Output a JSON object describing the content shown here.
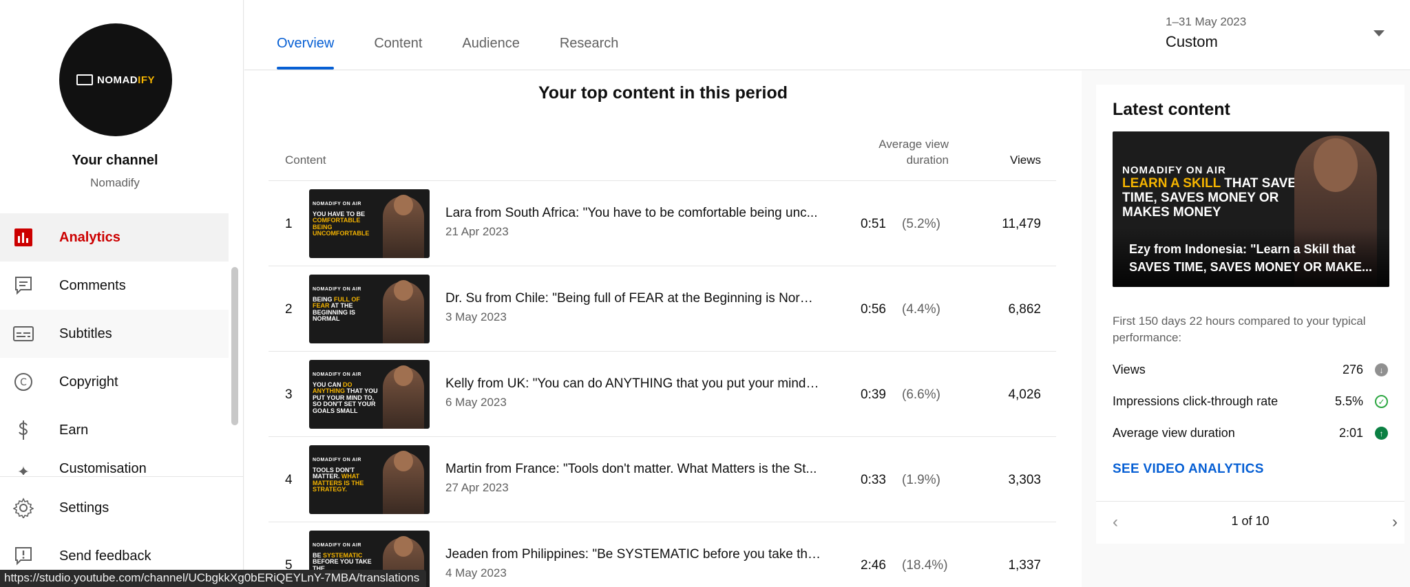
{
  "sidebar": {
    "logo_main": "NOMAD",
    "logo_accent": "IFY",
    "channel_title": "Your channel",
    "channel_name": "Nomadify",
    "items": [
      {
        "label": "Analytics",
        "icon": "analytics-icon"
      },
      {
        "label": "Comments",
        "icon": "comments-icon"
      },
      {
        "label": "Subtitles",
        "icon": "subtitles-icon"
      },
      {
        "label": "Copyright",
        "icon": "copyright-icon"
      },
      {
        "label": "Earn",
        "icon": "dollar-icon"
      },
      {
        "label": "Customisation",
        "icon": "customisation-icon"
      }
    ],
    "bottom_items": [
      {
        "label": "Settings",
        "icon": "gear-icon"
      },
      {
        "label": "Send feedback",
        "icon": "feedback-icon"
      }
    ]
  },
  "header": {
    "tabs": [
      "Overview",
      "Content",
      "Audience",
      "Research"
    ],
    "active_tab": "Overview",
    "date_range_sub": "1–31 May 2023",
    "date_range_value": "Custom"
  },
  "top_content": {
    "title": "Your top content in this period",
    "columns": {
      "content": "Content",
      "avd_line1": "Average view",
      "avd_line2": "duration",
      "views": "Views"
    },
    "rows": [
      {
        "rank": "1",
        "title": "Lara from South Africa: \"You have to be comfortable being unc...",
        "date": "21 Apr 2023",
        "duration": "0:51",
        "pct": "(5.2%)",
        "views": "11,479",
        "thumb_a": "You have to be ",
        "thumb_hl": "comfortable being uncomfortable",
        "thumb_b": ""
      },
      {
        "rank": "2",
        "title": "Dr. Su from Chile: \"Being full of FEAR at the Beginning is Norm...",
        "date": "3 May 2023",
        "duration": "0:56",
        "pct": "(4.4%)",
        "views": "6,862",
        "thumb_a": "Being ",
        "thumb_hl": "full of fear",
        "thumb_b": " at the beginning is normal"
      },
      {
        "rank": "3",
        "title": "Kelly from UK: \"You can do ANYTHING that you put your mind t...",
        "date": "6 May 2023",
        "duration": "0:39",
        "pct": "(6.6%)",
        "views": "4,026",
        "thumb_a": "You can ",
        "thumb_hl": "do anything",
        "thumb_b": " that you put your mind to, so don't set your goals small"
      },
      {
        "rank": "4",
        "title": "Martin from France: \"Tools don't matter. What Matters is the St...",
        "date": "27 Apr 2023",
        "duration": "0:33",
        "pct": "(1.9%)",
        "views": "3,303",
        "thumb_a": "Tools don't matter. ",
        "thumb_hl": "What matters is the strategy.",
        "thumb_b": ""
      },
      {
        "rank": "5",
        "title": "Jeaden from Philippines: \"Be SYSTEMATIC before you take the...",
        "date": "4 May 2023",
        "duration": "2:46",
        "pct": "(18.4%)",
        "views": "1,337",
        "thumb_a": "Be ",
        "thumb_hl": "systematic",
        "thumb_b": " before you take the"
      }
    ],
    "thumb_brand": "NOMADIFY ON AIR"
  },
  "latest": {
    "title": "Latest content",
    "thumb_brand": "NOMADIFY ON AIR",
    "thumb_hl": "Learn a skill",
    "thumb_text": " that saves time, saves money or makes money",
    "caption": "Ezy from Indonesia: \"Learn a Skill that SAVES TIME, SAVES MONEY OR MAKE...",
    "note": "First 150 days 22 hours compared to your typical performance:",
    "metrics": [
      {
        "label": "Views",
        "value": "276",
        "status": "down"
      },
      {
        "label": "Impressions click-through rate",
        "value": "5.5%",
        "status": "check"
      },
      {
        "label": "Average view duration",
        "value": "2:01",
        "status": "up"
      }
    ],
    "link": "SEE VIDEO ANALYTICS",
    "pager": "1 of 10"
  },
  "status_url": "https://studio.youtube.com/channel/UCbgkkXg0bERiQEYLnY-7MBA/translations"
}
